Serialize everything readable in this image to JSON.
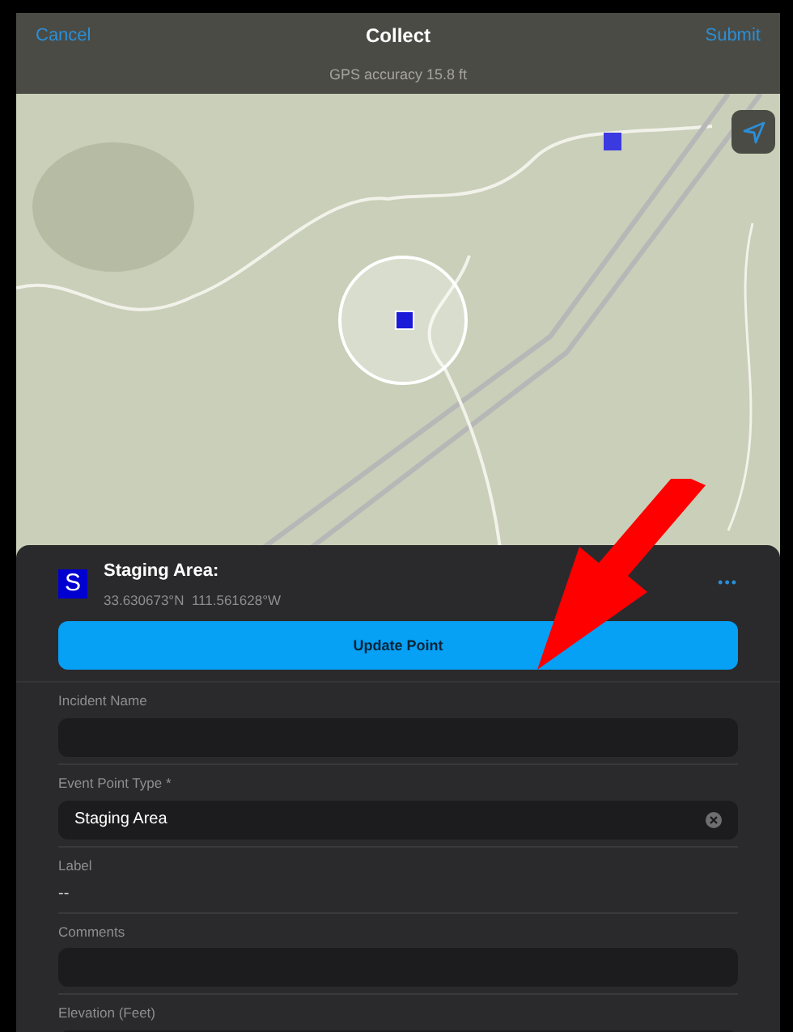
{
  "nav": {
    "cancel": "Cancel",
    "title": "Collect",
    "submit": "Submit"
  },
  "gps": "GPS accuracy 15.8 ft",
  "feature": {
    "badge": "S",
    "title": "Staging Area:",
    "coordinates": "33.630673°N  111.561628°W",
    "more": "•••",
    "action": "Update Point"
  },
  "fields": [
    {
      "kind": "input",
      "label": "Incident Name"
    },
    {
      "kind": "select",
      "label": "Event Point Type *",
      "value": "Staging Area"
    },
    {
      "kind": "readonly",
      "label": "Label",
      "value": "--"
    },
    {
      "kind": "input",
      "label": "Comments"
    },
    {
      "kind": "input",
      "label": "Elevation (Feet)"
    }
  ]
}
